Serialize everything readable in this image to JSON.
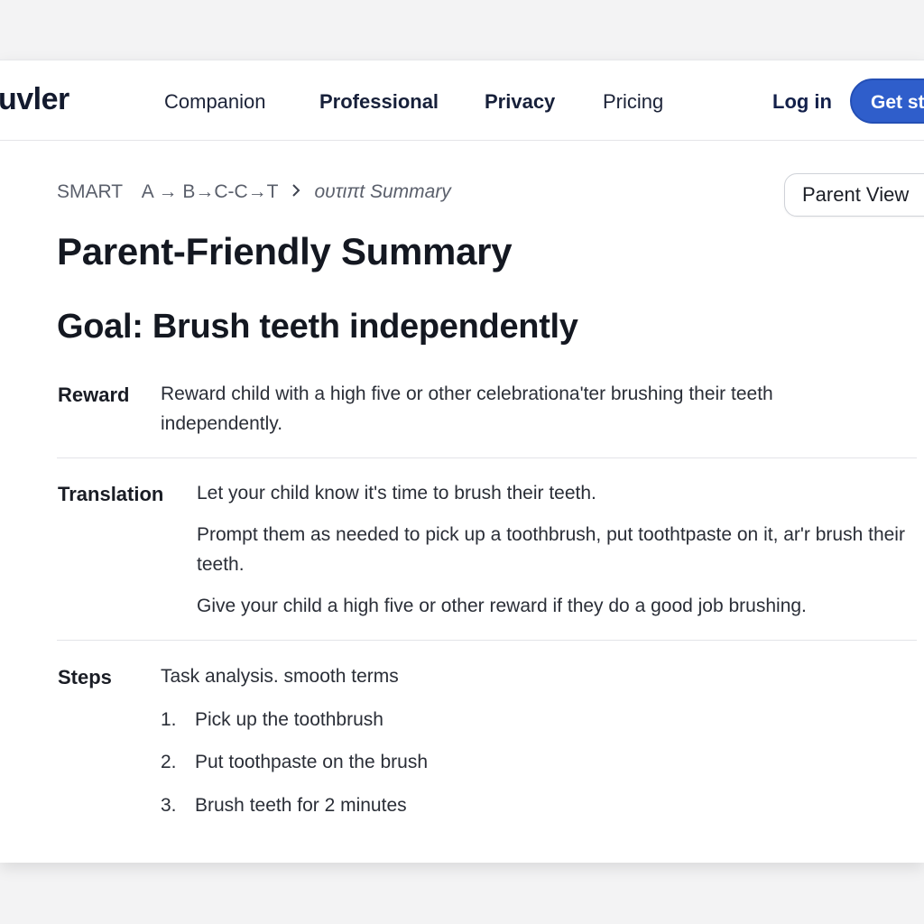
{
  "header": {
    "logo": "uvler",
    "nav": [
      "Companion",
      "Professional",
      "Privacy",
      "Pricing"
    ],
    "login": "Log in",
    "cta": "Get st"
  },
  "breadcrumb": {
    "items": [
      "SMART",
      "A → B→C-C→T",
      "ουτιπt Summary"
    ]
  },
  "parent_view_button": "Parent View",
  "page_title": "Parent-Friendly Summary",
  "goal_title": "Goal: Brush teeth independently",
  "reward": {
    "label": "Reward",
    "text": "Reward child with a high five or other celebrationa'ter brushing their teeth independently."
  },
  "translation": {
    "label": "Translation",
    "lines": [
      "Let your child know it's time to brush their teeth.",
      "Prompt them as needed to pick up a toothbrush,  put toothtpaste on it, ar'r brush their teeth.",
      "Give your child a high five or other reward if they do a good job brushing."
    ]
  },
  "steps": {
    "label": "Steps",
    "intro": "Task analysis. smooth terms",
    "items": [
      {
        "num": "1.",
        "text": "Pick up the toothbrush"
      },
      {
        "num": "2.",
        "text": "Put toothpaste on the brush"
      },
      {
        "num": "3.",
        "text": "Brush teeth for 2 minutes"
      }
    ]
  }
}
